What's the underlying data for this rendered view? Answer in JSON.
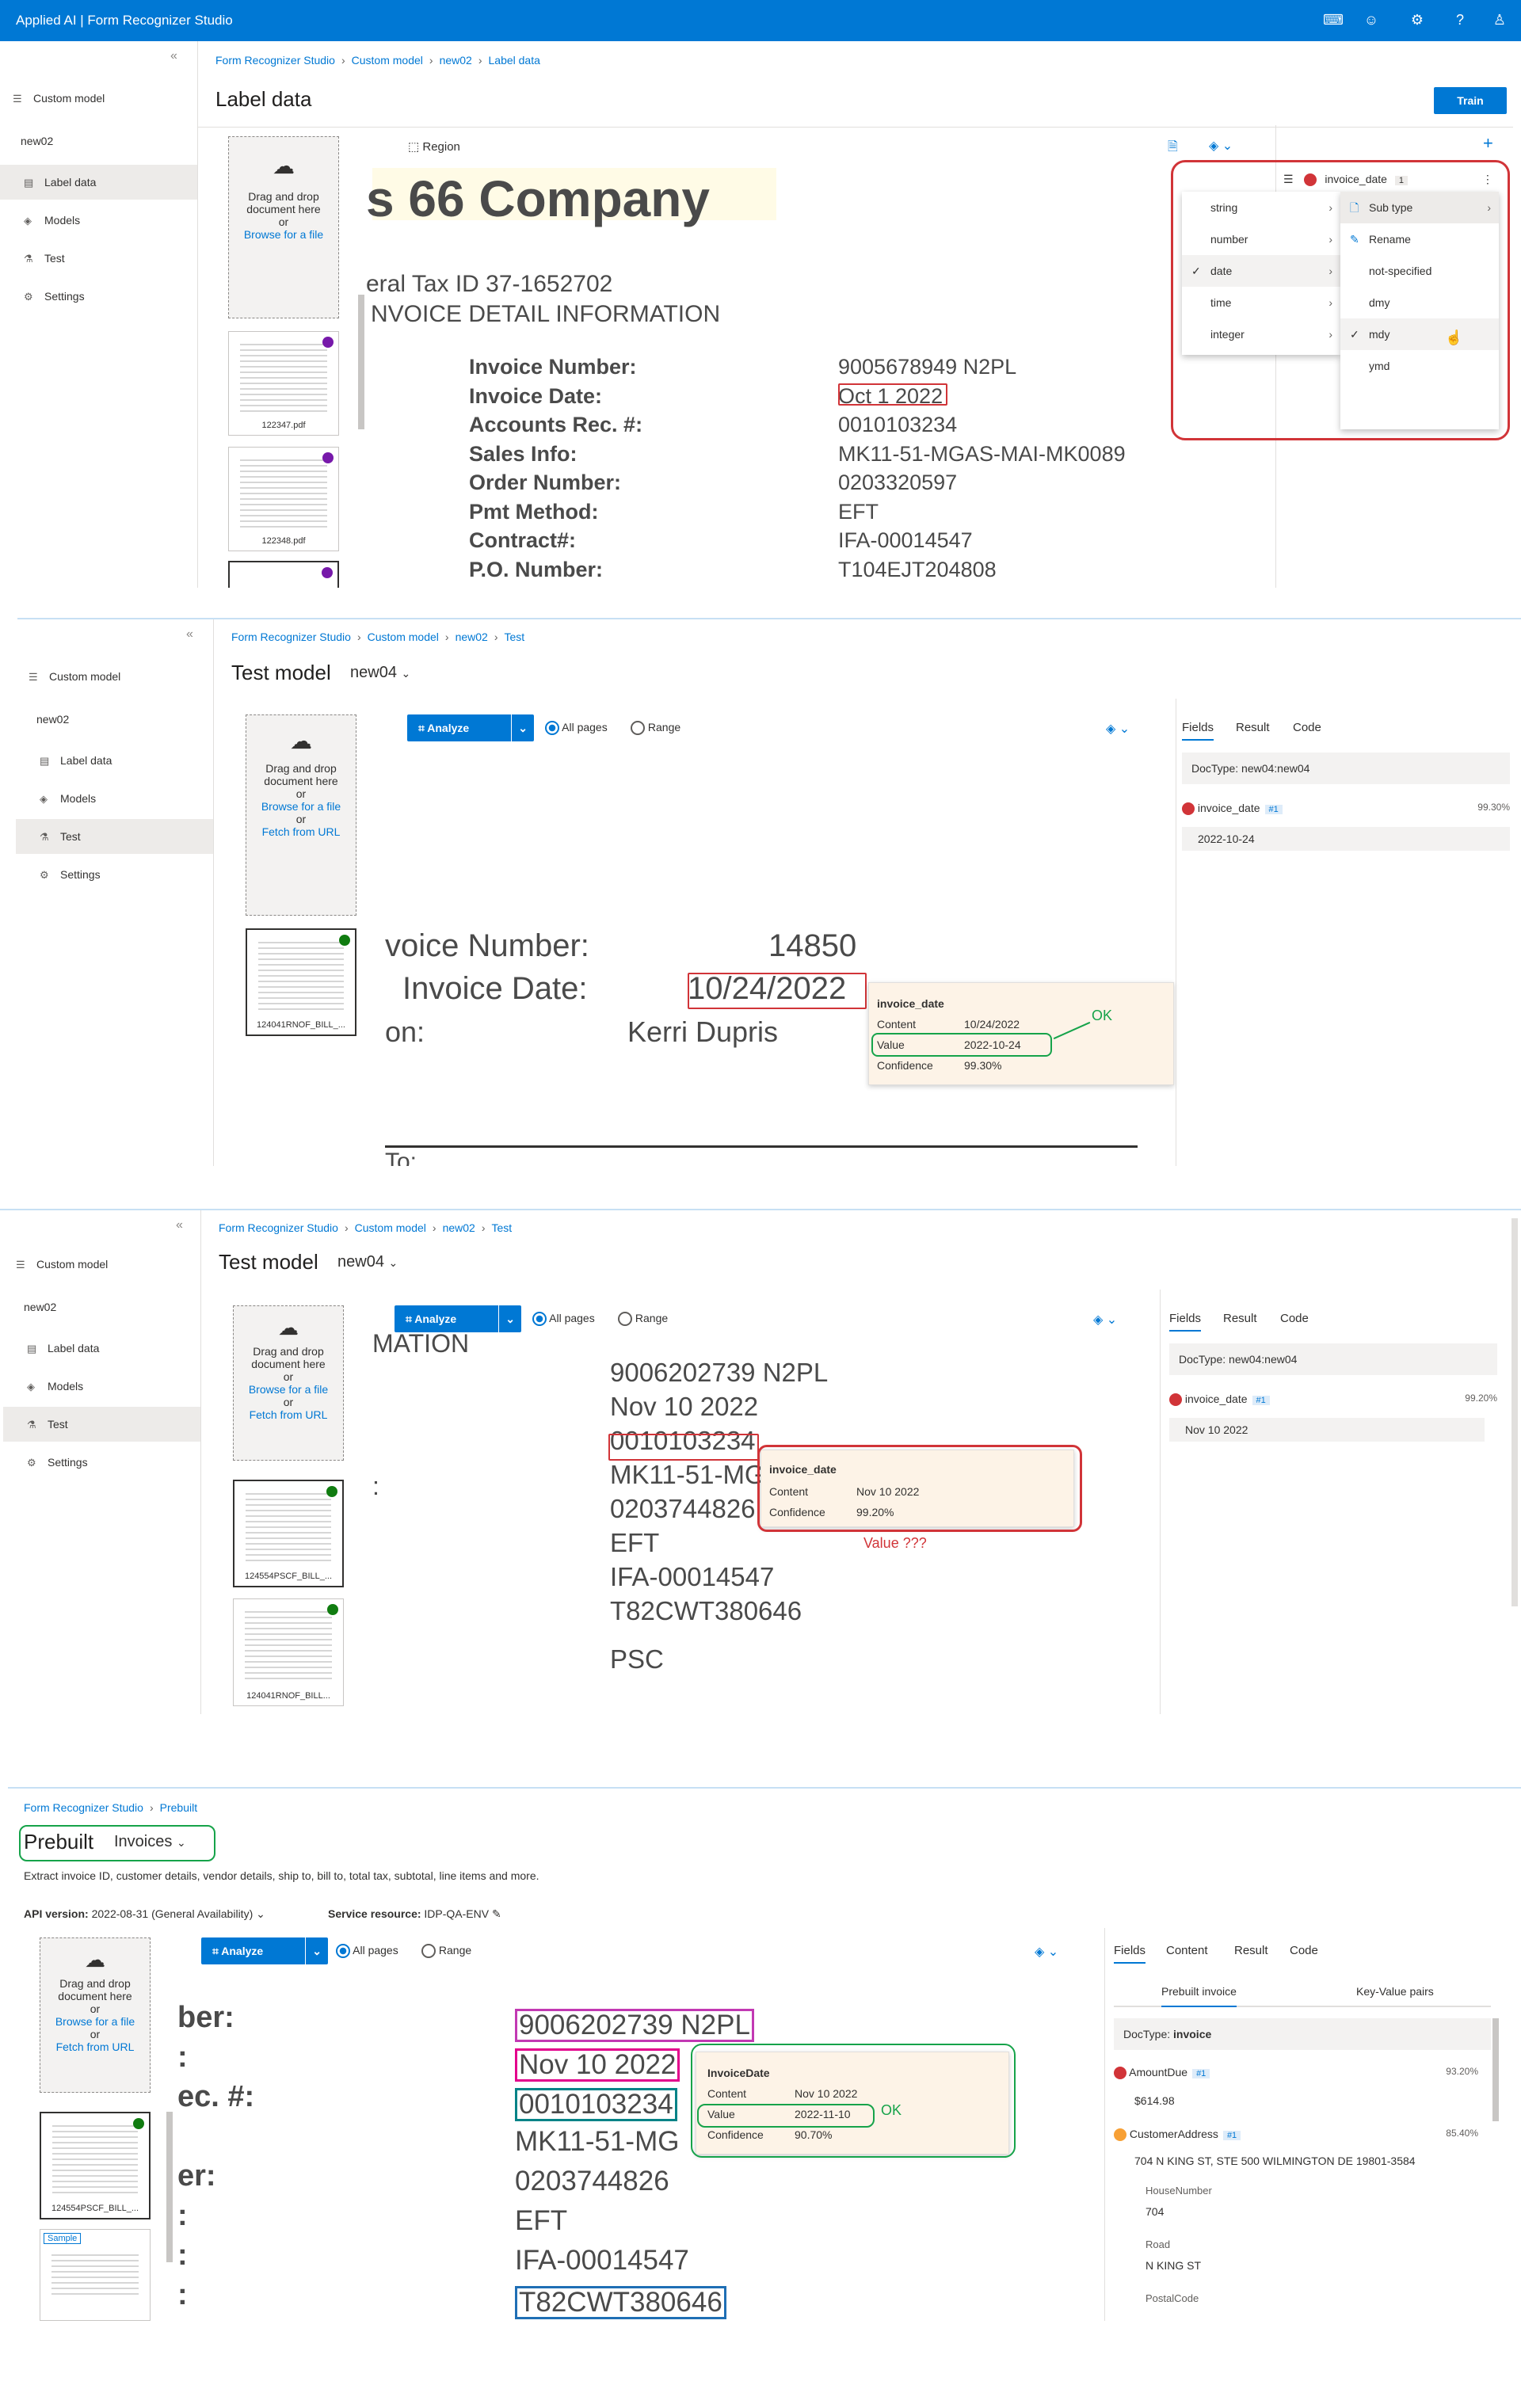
{
  "app": {
    "title": "Applied AI | Form Recognizer Studio"
  },
  "nav": {
    "custom_model": "Custom model",
    "project": "new02",
    "label_data": "Label data",
    "models": "Models",
    "test": "Test",
    "settings": "Settings"
  },
  "crumbs": {
    "studio": "Form Recognizer Studio",
    "custom_model": "Custom model",
    "project": "new02",
    "label_data": "Label data",
    "test": "Test",
    "prebuilt": "Prebuilt"
  },
  "dropzone": {
    "line1": "Drag and drop",
    "line2": "document here",
    "or": "or",
    "browse": "Browse for a file",
    "fetch": "Fetch from URL"
  },
  "p1": {
    "title": "Label data",
    "train": "Train",
    "region": "Region",
    "thumbs": [
      "122347.pdf",
      "122348.pdf"
    ],
    "doc": {
      "company": "s 66 Company",
      "tax": "eral Tax ID 37-1652702",
      "detail": "NVOICE DETAIL INFORMATION",
      "labels": [
        "Invoice Number:",
        "Invoice Date:",
        "Accounts Rec. #:",
        "Sales Info:",
        "Order Number:",
        "Pmt Method:",
        "Contract#:",
        "P.O. Number:"
      ],
      "values": [
        "9005678949 N2PL",
        "Oct 1 2022",
        "0010103234",
        "MK11-51-MGAS-MAI-MK0089",
        "0203320597",
        "EFT",
        "IFA-00014547",
        "T104EJT204808"
      ]
    },
    "field": {
      "name": "invoice_date",
      "count": "1"
    },
    "types": [
      "string",
      "number",
      "date",
      "time",
      "integer"
    ],
    "submenu": {
      "subtype": "Sub type",
      "rename": "Rename",
      "options": [
        "not-specified",
        "dmy",
        "mdy",
        "ymd"
      ]
    }
  },
  "p2": {
    "title": "Test model",
    "model": "new04",
    "analyze": "Analyze",
    "all_pages": "All pages",
    "range": "Range",
    "tabs": [
      "Fields",
      "Result",
      "Code"
    ],
    "doctype_label": "DocType:",
    "doctype": "new04:new04",
    "field": {
      "name": "invoice_date",
      "badge": "#1",
      "confidence": "99.30%",
      "value": "2022-10-24"
    },
    "thumb": "124041RNOF_BILL_...",
    "doc": {
      "l1": "voice Number:",
      "v1": "14850",
      "l2": "Invoice Date:",
      "v2": "10/24/2022",
      "l3": "on:",
      "v3": "Kerri Dupris",
      "l4": "To:"
    },
    "popup": {
      "title": "invoice_date",
      "content_k": "Content",
      "content_v": "10/24/2022",
      "value_k": "Value",
      "value_v": "2022-10-24",
      "conf_k": "Confidence",
      "conf_v": "99.30%"
    },
    "ok": "OK"
  },
  "p3": {
    "title": "Test model",
    "model": "new04",
    "analyze": "Analyze",
    "all_pages": "All pages",
    "range": "Range",
    "tabs": [
      "Fields",
      "Result",
      "Code"
    ],
    "doctype_label": "DocType:",
    "doctype": "new04:new04",
    "field": {
      "name": "invoice_date",
      "badge": "#1",
      "confidence": "99.20%",
      "value": "Nov 10 2022"
    },
    "thumbs": [
      "124554PSCF_BILL_...",
      "124041RNOF_BILL..."
    ],
    "doc": {
      "head": "MATION",
      "lines": [
        "9006202739 N2PL",
        "Nov 10 2022",
        "0010103234",
        "MK11-51-MG",
        "0203744826",
        "EFT",
        "IFA-00014547",
        "T82CWT380646",
        "PSC"
      ]
    },
    "popup": {
      "title": "invoice_date",
      "content_k": "Content",
      "content_v": "Nov 10 2022",
      "conf_k": "Confidence",
      "conf_v": "99.20%"
    },
    "note": "Value ???"
  },
  "p4": {
    "title": "Prebuilt",
    "model": "Invoices",
    "desc": "Extract invoice ID, customer details, vendor details, ship to, bill to, total tax, subtotal, line items and more.",
    "api_label": "API version:",
    "api": "2022-08-31 (General Availability)",
    "res_label": "Service resource:",
    "res": "IDP-QA-ENV",
    "analyze": "Analyze",
    "all_pages": "All pages",
    "range": "Range",
    "tabs": [
      "Fields",
      "Content",
      "Result",
      "Code"
    ],
    "subtabs": [
      "Prebuilt invoice",
      "Key-Value pairs"
    ],
    "doctype_label": "DocType:",
    "doctype": "invoice",
    "f1": {
      "name": "AmountDue",
      "badge": "#1",
      "confidence": "93.20%",
      "value": "$614.98"
    },
    "f2": {
      "name": "CustomerAddress",
      "badge": "#1",
      "confidence": "85.40%",
      "value": "704 N KING ST, STE 500 WILMINGTON DE 19801-3584"
    },
    "sub": [
      {
        "k": "HouseNumber",
        "v": "704"
      },
      {
        "k": "Road",
        "v": "N KING ST"
      },
      {
        "k": "PostalCode",
        "v": ""
      }
    ],
    "thumb": "124554PSCF_BILL_...",
    "sample": "Sample",
    "doc": {
      "labels": [
        "ber:",
        ":",
        "ec. #:",
        "",
        "er:",
        ":",
        ":",
        ":"
      ],
      "lines": [
        "9006202739 N2PL",
        "Nov 10 2022",
        "0010103234",
        "MK11-51-MG",
        "0203744826",
        "EFT",
        "IFA-00014547",
        "T82CWT380646"
      ]
    },
    "popup": {
      "title": "InvoiceDate",
      "content_k": "Content",
      "content_v": "Nov 10 2022",
      "value_k": "Value",
      "value_v": "2022-11-10",
      "conf_k": "Confidence",
      "conf_v": "90.70%"
    },
    "ok": "OK"
  }
}
